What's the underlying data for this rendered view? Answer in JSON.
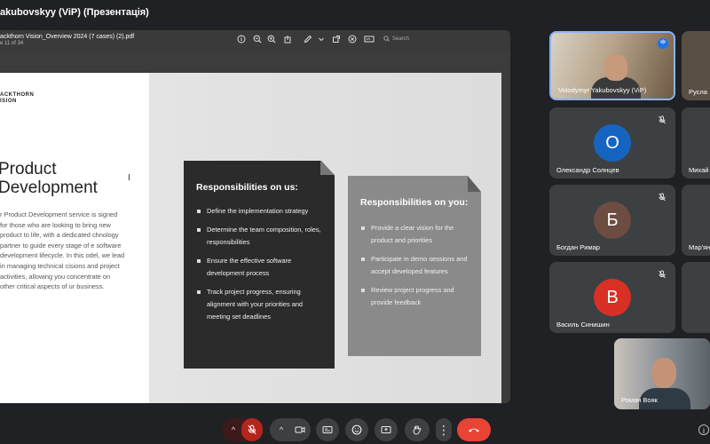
{
  "window": {
    "title": "akubovskyy (ViP) (Презентація)"
  },
  "viewer": {
    "filename": "ackthorn Vision_Overview 2024 (7 cases) (2).pdf",
    "page_info": "e 11 of 34",
    "search_placeholder": "Search",
    "tool_icons": [
      "info-icon",
      "zoom-out-icon",
      "zoom-in-icon",
      "share-icon",
      "draw-icon",
      "chevron-down-icon",
      "external-icon",
      "close-circle-icon",
      "sign-icon"
    ]
  },
  "slide": {
    "logo_line1": "ACKTHORN",
    "logo_line2": "ISION",
    "title": "Product Development",
    "description": "r Product Development service is signed for those who are looking to bring new product to life, with a dedicated chnology partner to guide every stage of e software development lifecycle. In this odel, we lead in managing technical cisions and project activities, allowing you concentrate on other critical aspects of ur business.",
    "card_us": {
      "title": "Responsibilities on us:",
      "items": [
        "Define the implementation strategy",
        "Determine the team composition, roles, responsibilities",
        "Ensure the effective software development process",
        "Track project progress, ensuring alignment with your priorities and meeting set deadlines"
      ]
    },
    "card_you": {
      "title": "Responsibilities on you:",
      "items": [
        "Provide a clear vision for the product and priorities",
        "Participate in demo sessions and accept developed features",
        "Review project progress and provide feedback"
      ]
    }
  },
  "participants": [
    {
      "name": "Volodymyr Yakubovskyy (ViP)",
      "type": "video",
      "speaking": true
    },
    {
      "name": "Русла",
      "type": "video"
    },
    {
      "name": "Олександр Солнцев",
      "initial": "О",
      "avatar_color": "#1565c0",
      "muted": true
    },
    {
      "name": "Михай",
      "type": "partial"
    },
    {
      "name": "Богдан Римар",
      "initial": "Б",
      "avatar_color": "#6d4c41",
      "muted": true
    },
    {
      "name": "Мар'ян",
      "type": "partial"
    },
    {
      "name": "Василь Синишин",
      "initial": "В",
      "avatar_color": "#d93025",
      "muted": true
    },
    {
      "name": "Роман Вояк",
      "type": "self"
    }
  ],
  "colors": {
    "background": "#202124",
    "tile": "#3c4043",
    "active_border": "#8ab4f8",
    "hangup": "#ea4335",
    "mic_off": "#b3261e"
  },
  "controls": {
    "mic_chevron": "^",
    "cam_chevron": "^",
    "more_dots": "⋮",
    "icons": [
      "mic-off-icon",
      "camera-icon",
      "captions-icon",
      "emoji-icon",
      "present-icon",
      "raise-hand-icon",
      "more-icon",
      "hangup-icon"
    ]
  }
}
